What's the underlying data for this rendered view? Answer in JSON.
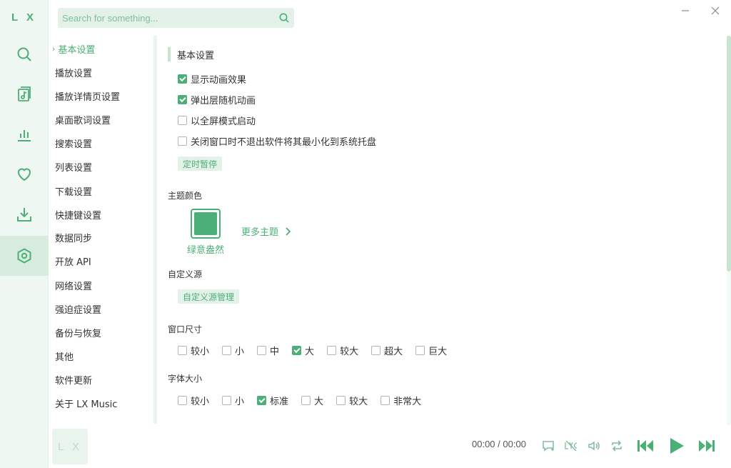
{
  "app": {
    "logo": "L X",
    "accent": "#4caf77"
  },
  "rail": {
    "items": [
      {
        "icon": "search-icon"
      },
      {
        "icon": "music-file-icon"
      },
      {
        "icon": "chart-icon"
      },
      {
        "icon": "heart-icon"
      },
      {
        "icon": "download-icon"
      },
      {
        "icon": "settings-icon",
        "active": true
      }
    ]
  },
  "search": {
    "placeholder": "Search for something..."
  },
  "menu": {
    "items": [
      {
        "label": "基本设置",
        "active": true
      },
      {
        "label": "播放设置"
      },
      {
        "label": "播放详情页设置"
      },
      {
        "label": "桌面歌词设置"
      },
      {
        "label": "搜索设置"
      },
      {
        "label": "列表设置"
      },
      {
        "label": "下载设置"
      },
      {
        "label": "快捷键设置"
      },
      {
        "label": "数据同步"
      },
      {
        "label": "开放 API"
      },
      {
        "label": "网络设置"
      },
      {
        "label": "强迫症设置"
      },
      {
        "label": "备份与恢复"
      },
      {
        "label": "其他"
      },
      {
        "label": "软件更新"
      },
      {
        "label": "关于 LX Music"
      }
    ]
  },
  "basic": {
    "title": "基本设置",
    "options": [
      {
        "label": "显示动画效果",
        "checked": true
      },
      {
        "label": "弹出层随机动画",
        "checked": true
      },
      {
        "label": "以全屏模式启动",
        "checked": false
      },
      {
        "label": "关闭窗口时不退出软件将其最小化到系统托盘",
        "checked": false
      }
    ],
    "timer_button": "定时暂停"
  },
  "theme": {
    "label": "主题颜色",
    "current": "绿意盎然",
    "more": "更多主题"
  },
  "source": {
    "label": "自定义源",
    "button": "自定义源管理"
  },
  "window_size": {
    "label": "窗口尺寸",
    "options": [
      {
        "label": "较小",
        "checked": false
      },
      {
        "label": "小",
        "checked": false
      },
      {
        "label": "中",
        "checked": false
      },
      {
        "label": "大",
        "checked": true
      },
      {
        "label": "较大",
        "checked": false
      },
      {
        "label": "超大",
        "checked": false
      },
      {
        "label": "巨大",
        "checked": false
      }
    ]
  },
  "font_size": {
    "label": "字体大小",
    "options": [
      {
        "label": "较小",
        "checked": false
      },
      {
        "label": "小",
        "checked": false
      },
      {
        "label": "标准",
        "checked": true
      },
      {
        "label": "大",
        "checked": false
      },
      {
        "label": "较大",
        "checked": false
      },
      {
        "label": "非常大",
        "checked": false
      }
    ]
  },
  "player": {
    "cover_text": "L X",
    "current_time": "00:00",
    "separator": "/",
    "total_time": "00:00"
  }
}
